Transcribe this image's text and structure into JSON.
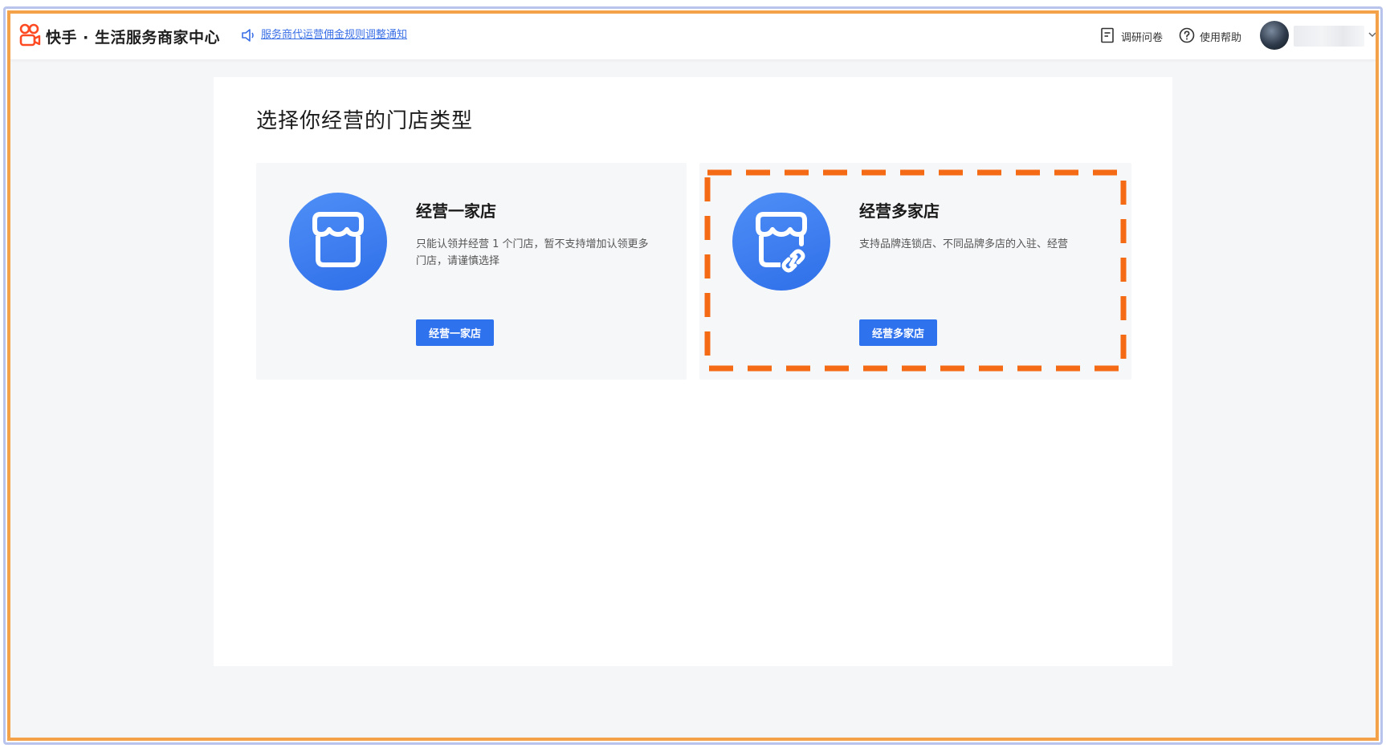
{
  "header": {
    "brand": "快手 · 生活服务商家中心",
    "notice_link": "服务商代运营佣金规则调整通知",
    "survey_label": "调研问卷",
    "help_label": "使用帮助"
  },
  "main": {
    "title": "选择你经营的门店类型",
    "cards": [
      {
        "title": "经营一家店",
        "description": "只能认领并经营 1 个门店，暂不支持增加认领更多门店，请谨慎选择",
        "button": "经营一家店",
        "icon": "store-icon"
      },
      {
        "title": "经营多家店",
        "description": "支持品牌连锁店、不同品牌多店的入驻、经营",
        "button": "经营多家店",
        "icon": "store-link-icon"
      }
    ]
  },
  "colors": {
    "primary": "#2f72ee",
    "highlight": "#f56a14",
    "frame": "#f3a24a"
  }
}
